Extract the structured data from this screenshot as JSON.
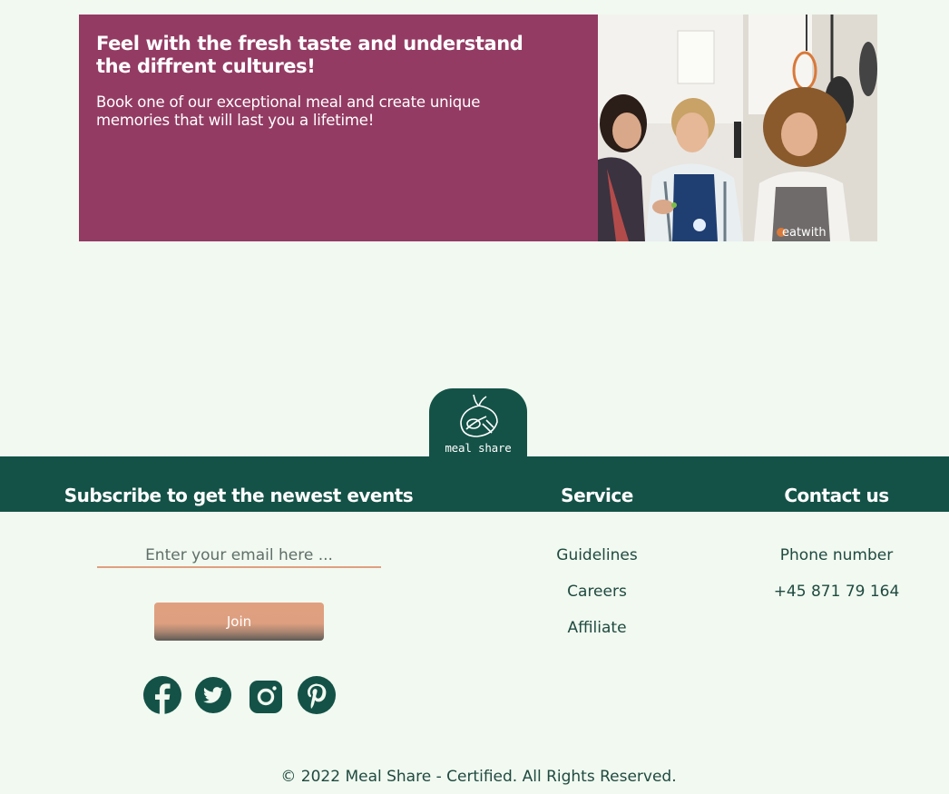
{
  "banner": {
    "heading": "Feel with the fresh taste and understand the diffrent cultures!",
    "subtext": "Book one of our exceptional meal and create unique memories that will last you a lifetime!",
    "photo_caption": "eatwith",
    "background_color": "#933b63"
  },
  "logo": {
    "wordmark": "meal share",
    "icon": "leaf-spoon-icon"
  },
  "footer": {
    "band_color": "#145247",
    "subscribe": {
      "heading": "Subscribe to get the newest events",
      "email_placeholder": "Enter your email here ...",
      "join_label": "Join",
      "social_icons": [
        "facebook-icon",
        "twitter-icon",
        "instagram-icon",
        "pinterest-icon"
      ]
    },
    "service": {
      "heading": "Service",
      "links": [
        "Guidelines",
        "Careers",
        "Affiliate"
      ]
    },
    "contact": {
      "heading": "Contact us",
      "phone_label": "Phone number",
      "phone_number": "+45 871 79 164"
    },
    "copyright": "© 2022 Meal Share - Certified. All Rights Reserved."
  }
}
